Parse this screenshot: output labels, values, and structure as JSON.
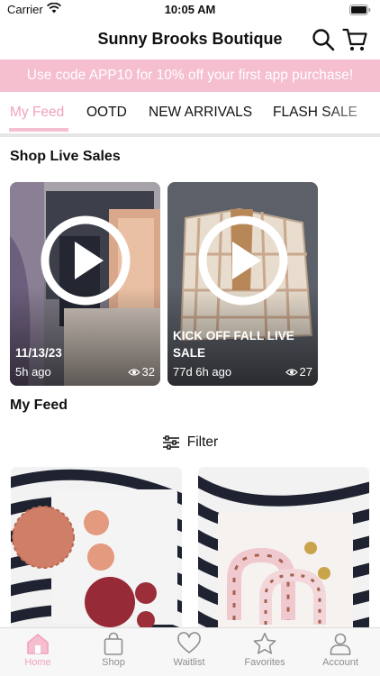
{
  "status_bar": {
    "carrier": "Carrier",
    "time": "10:05 AM"
  },
  "header": {
    "title": "Sunny Brooks Boutique",
    "search_icon": "search-icon",
    "cart_icon": "cart-icon"
  },
  "promo": {
    "text": "Use code APP10 for 10% off your first app purchase!",
    "color": "#f5bfd0"
  },
  "tabs": [
    {
      "label": "My Feed",
      "active": true
    },
    {
      "label": "OOTD"
    },
    {
      "label": "NEW ARRIVALS"
    },
    {
      "label": "FLASH SALE"
    }
  ],
  "live_sales": {
    "title": "Shop Live Sales",
    "items": [
      {
        "title": "11/13/23",
        "age": "5h ago",
        "views": "32"
      },
      {
        "title": "KICK OFF FALL LIVE SALE",
        "age": "77d 6h ago",
        "views": "27"
      }
    ]
  },
  "feed": {
    "title": "My Feed",
    "filter_label": "Filter"
  },
  "tabbar": [
    {
      "label": "Home",
      "icon": "home-icon",
      "active": true
    },
    {
      "label": "Shop",
      "icon": "bag-icon"
    },
    {
      "label": "Waitlist",
      "icon": "heart-icon"
    },
    {
      "label": "Favorites",
      "icon": "star-icon"
    },
    {
      "label": "Account",
      "icon": "person-icon"
    }
  ],
  "colors": {
    "accent": "#f0a3bd",
    "banner": "#f5bfd0",
    "inactive": "#8e8e93"
  }
}
